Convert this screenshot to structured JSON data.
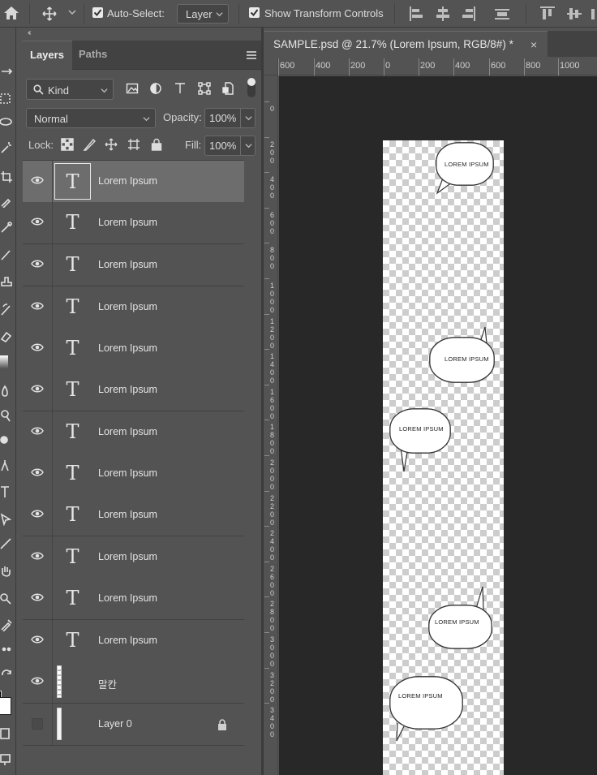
{
  "options_bar": {
    "auto_select_label": "Auto-Select:",
    "auto_select_checked": true,
    "auto_select_target": "Layer",
    "show_transform_label": "Show Transform Controls",
    "show_transform_checked": true
  },
  "panel": {
    "collapse_glyph": "‹‹",
    "tabs": [
      {
        "label": "Layers",
        "active": true
      },
      {
        "label": "Paths",
        "active": false
      }
    ],
    "filter_kind": "Kind",
    "blend_mode": "Normal",
    "opacity_label": "Opacity:",
    "opacity_value": "100%",
    "lock_label": "Lock:",
    "fill_label": "Fill:",
    "fill_value": "100%"
  },
  "layers": [
    {
      "name": "Lorem Ipsum",
      "type": "text",
      "visible": true,
      "selected": true
    },
    {
      "name": "Lorem Ipsum",
      "type": "text",
      "visible": true
    },
    {
      "name": "Lorem Ipsum",
      "type": "text",
      "visible": true
    },
    {
      "name": "Lorem Ipsum",
      "type": "text",
      "visible": true
    },
    {
      "name": "Lorem Ipsum",
      "type": "text",
      "visible": true
    },
    {
      "name": "Lorem Ipsum",
      "type": "text",
      "visible": true
    },
    {
      "name": "Lorem Ipsum",
      "type": "text",
      "visible": true
    },
    {
      "name": "Lorem Ipsum",
      "type": "text",
      "visible": true
    },
    {
      "name": "Lorem Ipsum",
      "type": "text",
      "visible": true
    },
    {
      "name": "Lorem Ipsum",
      "type": "text",
      "visible": true
    },
    {
      "name": "Lorem Ipsum",
      "type": "text",
      "visible": true
    },
    {
      "name": "Lorem Ipsum",
      "type": "text",
      "visible": true
    },
    {
      "name": "말칸",
      "type": "image",
      "visible": true
    },
    {
      "name": "Layer 0",
      "type": "image",
      "visible": false,
      "locked": true
    }
  ],
  "document": {
    "tab_title": "SAMPLE.psd @ 21.7% (Lorem Ipsum, RGB/8#) *",
    "close_glyph": "×",
    "ruler_numbers": [
      "600",
      "400",
      "200",
      "0",
      "200",
      "400",
      "600",
      "800",
      "1000"
    ],
    "vertical_ruler_labels": [
      "0",
      "200",
      "400",
      "600",
      "800",
      "1000",
      "1200",
      "1400",
      "1600",
      "1800",
      "2000",
      "2200",
      "2400",
      "2600",
      "2800",
      "3000",
      "3200",
      "3400"
    ],
    "bubble_text": "LOREM IPSUM",
    "bubble_count": 5
  }
}
